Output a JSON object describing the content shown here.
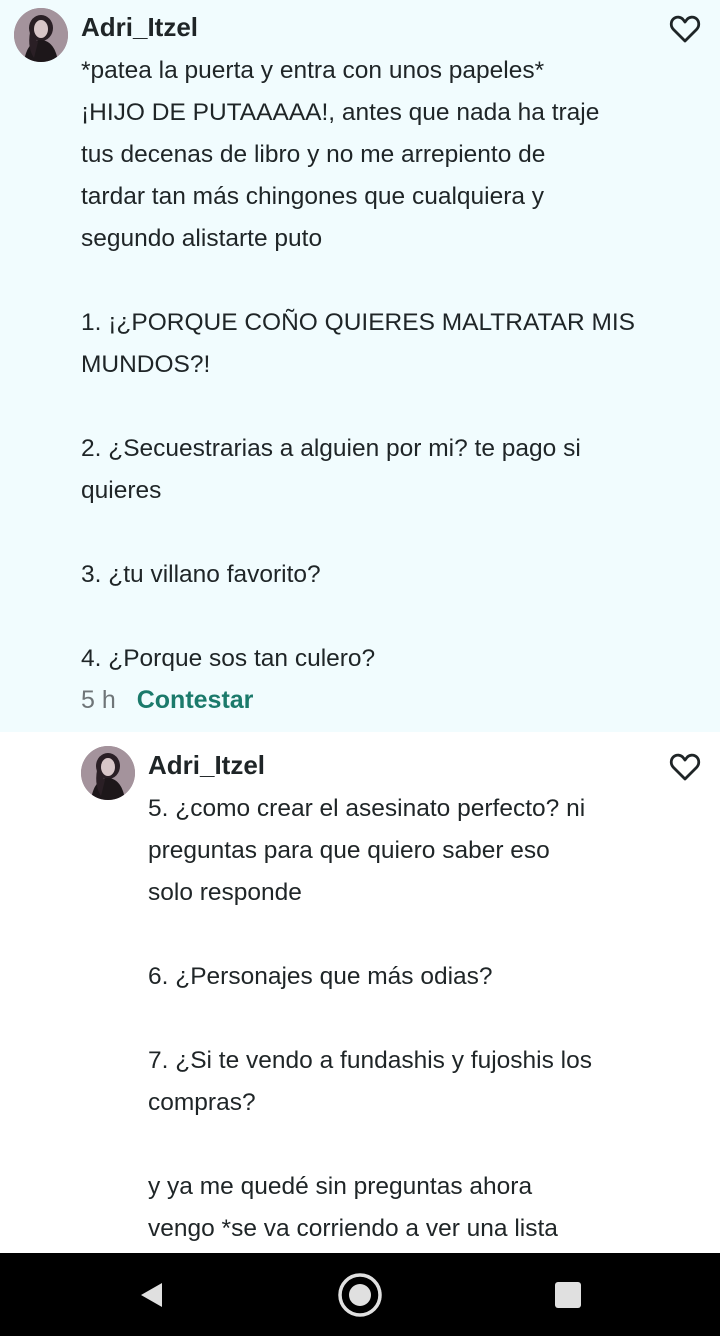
{
  "comments": [
    {
      "username": "Adri_Itzel",
      "lines": [
        "*patea la puerta y entra con unos papeles*",
        "¡HIJO DE PUTAAAAA!, antes que nada ha traje",
        "tus decenas de libro y no me arrepiento de",
        "tardar tan más chingones que cualquiera y",
        "segundo alistarte puto",
        "",
        "1. ¡¿PORQUE COÑO QUIERES MALTRATAR MIS",
        "MUNDOS?!",
        "",
        "2. ¿Secuestrarias a alguien por mi? te pago si",
        "quieres",
        "",
        "3. ¿tu villano favorito?",
        "",
        "4. ¿Porque sos tan culero?"
      ],
      "time": "5 h",
      "reply_label": "Contestar",
      "like_icon": "heart-outline-icon",
      "background": "#f1fcfe"
    },
    {
      "username": "Adri_Itzel",
      "lines": [
        "5. ¿como crear el asesinato perfecto? ni",
        "preguntas para que quiero saber eso",
        "solo responde",
        "",
        "6. ¿Personajes que más odias?",
        "",
        "7. ¿Si te vendo a fundashis y fujoshis los",
        "compras?",
        "",
        "y ya me quedé sin preguntas ahora",
        "vengo *se va corriendo a ver una lista"
      ],
      "like_icon": "heart-outline-icon",
      "background": "#ffffff"
    }
  ],
  "colors": {
    "accent": "#1b7a6b",
    "text": "#1f2527",
    "muted": "#6f7578",
    "navbar": "#000000"
  },
  "navbar": {
    "back_icon": "back-triangle-icon",
    "home_icon": "home-circle-icon",
    "recent_icon": "recents-square-icon"
  }
}
